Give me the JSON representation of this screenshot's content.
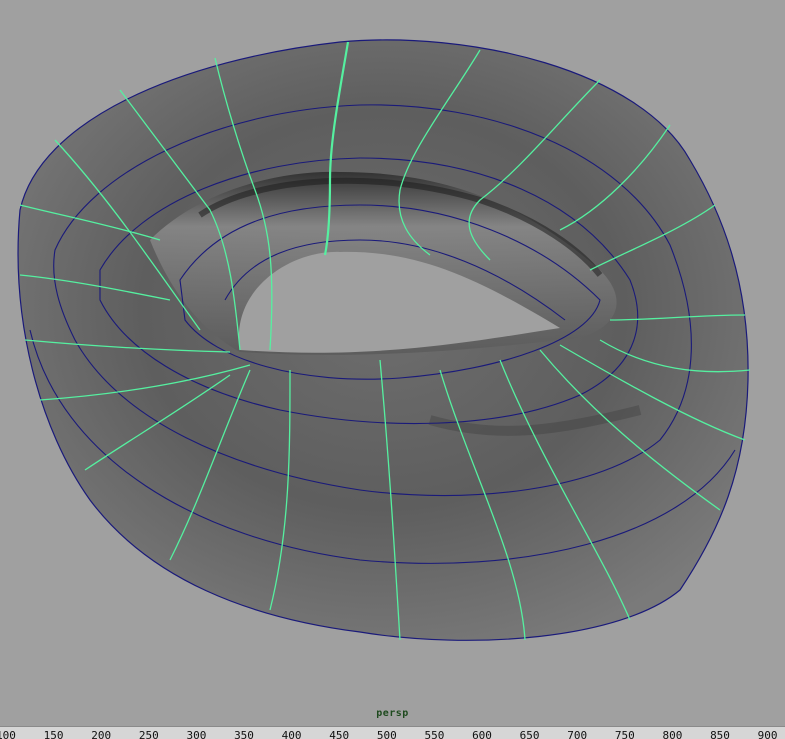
{
  "viewport": {
    "camera_label": "persp",
    "background_color": "#a0a0a0",
    "mesh_color": "#6b6b6b",
    "isoparm_color": "#55f0a0",
    "hull_color": "#1a1a7a"
  },
  "timeline": {
    "ticks": [
      "100",
      "150",
      "200",
      "250",
      "300",
      "350",
      "400",
      "450",
      "500",
      "550",
      "600",
      "650",
      "700",
      "750",
      "800",
      "850",
      "900"
    ]
  }
}
